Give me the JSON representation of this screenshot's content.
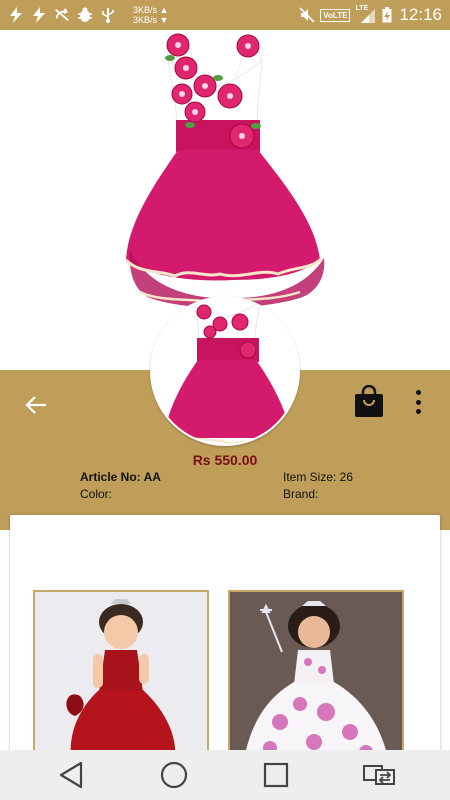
{
  "status_bar": {
    "net_up": "3KB/s ▲",
    "net_down": "3KB/s ▼",
    "volte": "VoLTE",
    "lte": "LTE",
    "time": "12:16"
  },
  "product": {
    "price": "Rs 550.00",
    "article_label": "Article No: AA",
    "item_size_label": "Item Size: 26",
    "color_label": "Color:",
    "brand_label": "Brand:"
  },
  "colors": {
    "accent": "#bf9e59",
    "price": "#7a0f17",
    "dress_pink": "#d01768",
    "tile_border": "#c9a765"
  },
  "icons": {
    "back": "arrow-left-icon",
    "bag": "shopping-bag-icon",
    "more": "more-vertical-icon",
    "nav_back": "triangle-back-icon",
    "nav_home": "circle-home-icon",
    "nav_recents": "square-recents-icon",
    "nav_switch": "switch-apps-icon"
  }
}
